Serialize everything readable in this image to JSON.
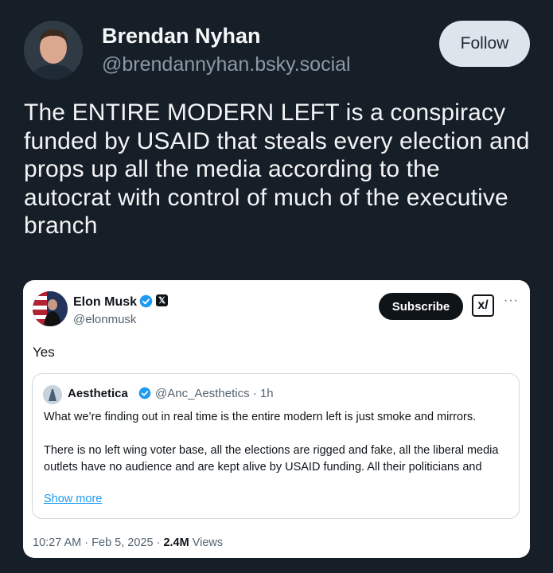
{
  "author": {
    "name": "Brendan Nyhan",
    "handle": "@brendannyhan.bsky.social",
    "follow_label": "Follow"
  },
  "post": {
    "text": "The ENTIRE MODERN LEFT is a conspiracy funded by USAID that steals every election and props up all the media according to the autocrat with control of much of the executive branch"
  },
  "embed": {
    "author_name": "Elon Musk",
    "author_handle": "@elonmusk",
    "subscribe_label": "Subscribe",
    "grok_label": "x/",
    "more_label": "···",
    "text": "Yes",
    "quote": {
      "author_name": "Aesthetica",
      "author_handle": "@Anc_Aesthetics · 1h",
      "paragraph1": "What we’re finding out in real time is the entire modern left is just smoke and mirrors.",
      "paragraph2": "There is no left wing voter base, all the elections are rigged and fake, all the liberal media outlets have no audience and are kept alive by USAID funding. All their politicians and",
      "show_more": "Show more"
    },
    "timestamp": "10:27 AM · Feb 5, 2025 · ",
    "views_count": "2.4M",
    "views_label": "Views"
  },
  "colors": {
    "background": "#161e27",
    "verified": "#1d9bf0",
    "link": "#1d9bf0"
  }
}
